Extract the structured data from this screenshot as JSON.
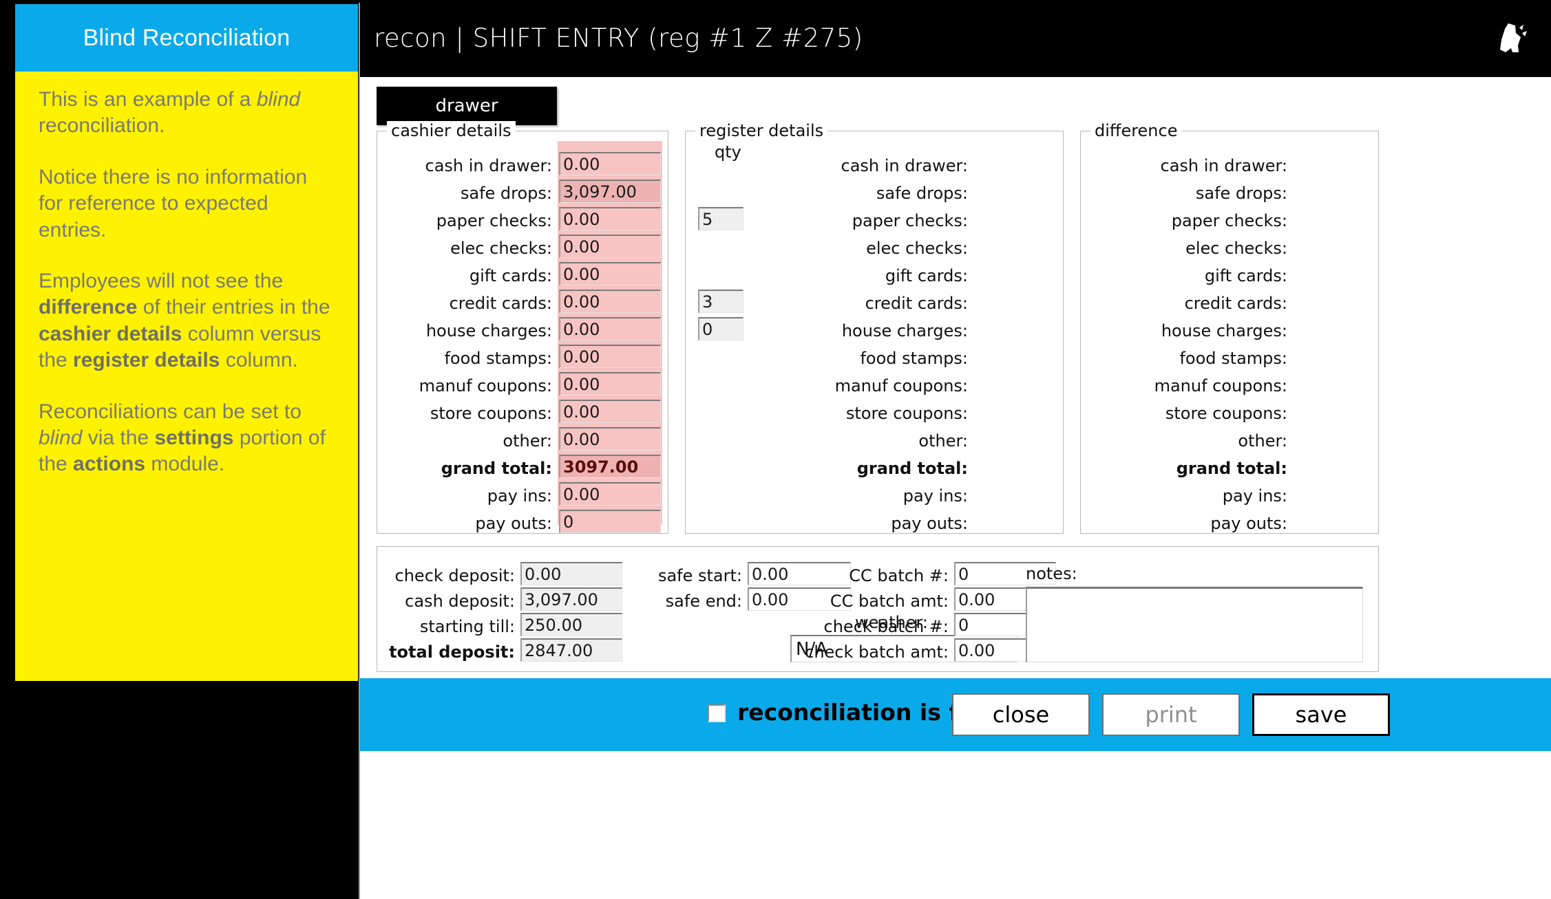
{
  "annotation": {
    "title": "Blind Reconciliation",
    "paragraphs": [
      [
        {
          "t": "This is an example of a ",
          "s": "n"
        },
        {
          "t": "blind",
          "s": "i"
        },
        {
          "t": " reconciliation.",
          "s": "n"
        }
      ],
      [
        {
          "t": "Notice there is no information for reference to expected entries.",
          "s": "n"
        }
      ],
      [
        {
          "t": "Employees will not see the ",
          "s": "n"
        },
        {
          "t": "difference",
          "s": "b"
        },
        {
          "t": " of their entries in the ",
          "s": "n"
        },
        {
          "t": "cashier details",
          "s": "b"
        },
        {
          "t": " column versus the ",
          "s": "n"
        },
        {
          "t": "register details",
          "s": "b"
        },
        {
          "t": " column.",
          "s": "n"
        }
      ],
      [
        {
          "t": "Reconciliations can be set to ",
          "s": "n"
        },
        {
          "t": "blind",
          "s": "i"
        },
        {
          "t": " via the ",
          "s": "n"
        },
        {
          "t": "settings",
          "s": "b"
        },
        {
          "t": " portion of the ",
          "s": "n"
        },
        {
          "t": "actions",
          "s": "b"
        },
        {
          "t": " module.",
          "s": "n"
        }
      ]
    ]
  },
  "window": {
    "title": "recon | SHIFT ENTRY  (reg #1  Z #275)",
    "logo_icon": "app-logo-icon"
  },
  "tabs": [
    {
      "label": "drawer",
      "active": true
    }
  ],
  "cashier_details": {
    "legend": "cashier details",
    "rows": [
      {
        "label": "cash in drawer:",
        "value": "0.00",
        "style": "pink"
      },
      {
        "label": "safe drops:",
        "value": "3,097.00",
        "style": "pink-calc"
      },
      {
        "label": "paper checks:",
        "value": "0.00",
        "style": "pink"
      },
      {
        "label": "elec checks:",
        "value": "0.00",
        "style": "pink"
      },
      {
        "label": "gift cards:",
        "value": "0.00",
        "style": "pink"
      },
      {
        "label": "credit cards:",
        "value": "0.00",
        "style": "pink"
      },
      {
        "label": "house charges:",
        "value": "0.00",
        "style": "pink"
      },
      {
        "label": "food stamps:",
        "value": "0.00",
        "style": "pink"
      },
      {
        "label": "manuf coupons:",
        "value": "0.00",
        "style": "pink"
      },
      {
        "label": "store coupons:",
        "value": "0.00",
        "style": "pink"
      },
      {
        "label": "other:",
        "value": "0.00",
        "style": "pink"
      },
      {
        "label": "grand total:",
        "value": "3097.00",
        "style": "pink-calc",
        "bold": true
      },
      {
        "label": "pay ins:",
        "value": "0.00",
        "style": "pink"
      },
      {
        "label": "pay outs:",
        "value": "0",
        "style": "pink"
      }
    ]
  },
  "register_details": {
    "legend": "register details",
    "qty_header": "qty",
    "rows": [
      {
        "label": "cash in drawer:",
        "qty": null,
        "value": ""
      },
      {
        "label": "safe drops:",
        "qty": null,
        "value": ""
      },
      {
        "label": "paper checks:",
        "qty": "5",
        "value": ""
      },
      {
        "label": "elec checks:",
        "qty": null,
        "value": ""
      },
      {
        "label": "gift cards:",
        "qty": null,
        "value": ""
      },
      {
        "label": "credit cards:",
        "qty": "3",
        "value": ""
      },
      {
        "label": "house charges:",
        "qty": "0",
        "value": ""
      },
      {
        "label": "food stamps:",
        "qty": null,
        "value": ""
      },
      {
        "label": "manuf coupons:",
        "qty": null,
        "value": ""
      },
      {
        "label": "store coupons:",
        "qty": null,
        "value": ""
      },
      {
        "label": "other:",
        "qty": null,
        "value": ""
      },
      {
        "label": "grand total:",
        "qty": null,
        "value": "",
        "bold": true
      },
      {
        "label": "pay ins:",
        "qty": null,
        "value": ""
      },
      {
        "label": "pay outs:",
        "qty": null,
        "value": ""
      }
    ]
  },
  "difference": {
    "legend": "difference",
    "rows": [
      {
        "label": "cash in drawer:",
        "value": ""
      },
      {
        "label": "safe drops:",
        "value": ""
      },
      {
        "label": "paper checks:",
        "value": ""
      },
      {
        "label": "elec checks:",
        "value": ""
      },
      {
        "label": "gift cards:",
        "value": ""
      },
      {
        "label": "credit cards:",
        "value": ""
      },
      {
        "label": "house charges:",
        "value": ""
      },
      {
        "label": "food stamps:",
        "value": ""
      },
      {
        "label": "manuf coupons:",
        "value": ""
      },
      {
        "label": "store coupons:",
        "value": ""
      },
      {
        "label": "other:",
        "value": ""
      },
      {
        "label": "grand total:",
        "value": "",
        "bold": true
      },
      {
        "label": "pay ins:",
        "value": ""
      },
      {
        "label": "pay outs:",
        "value": ""
      }
    ]
  },
  "bottom": {
    "col1": [
      {
        "label": "check deposit:",
        "value": "0.00",
        "style": "gray"
      },
      {
        "label": "cash deposit:",
        "value": "3,097.00",
        "style": "gray"
      },
      {
        "label": "starting till:",
        "value": "250.00",
        "style": "gray"
      },
      {
        "label": "total deposit:",
        "value": "2847.00",
        "style": "gray",
        "bold": true
      }
    ],
    "col2": [
      {
        "label": "safe start:",
        "value": "0.00",
        "style": "white"
      },
      {
        "label": "safe end:",
        "value": "0.00",
        "style": "white"
      }
    ],
    "weather_label": "weather:",
    "weather_value": "N/A",
    "col3": [
      {
        "label": "CC batch #:",
        "value": "0",
        "style": "white"
      },
      {
        "label": "CC batch amt:",
        "value": "0.00",
        "style": "white"
      },
      {
        "label": "check batch #:",
        "value": "0",
        "style": "white"
      },
      {
        "label": "check batch amt:",
        "value": "0.00",
        "style": "white"
      }
    ],
    "notes_label": "notes:",
    "notes_value": ""
  },
  "footer": {
    "final_checkbox_label": "reconciliation is final",
    "final_checked": false,
    "buttons": [
      {
        "label": "close",
        "state": "normal"
      },
      {
        "label": "print",
        "state": "disabled"
      },
      {
        "label": "save",
        "state": "default"
      }
    ]
  },
  "colors": {
    "accent_blue": "#0aaaea",
    "note_yellow": "#fff200",
    "pink_field": "#f7c3c3",
    "pink_calc_field": "#eeb2b2",
    "gray_field": "#efefef",
    "title_black": "#000000"
  }
}
